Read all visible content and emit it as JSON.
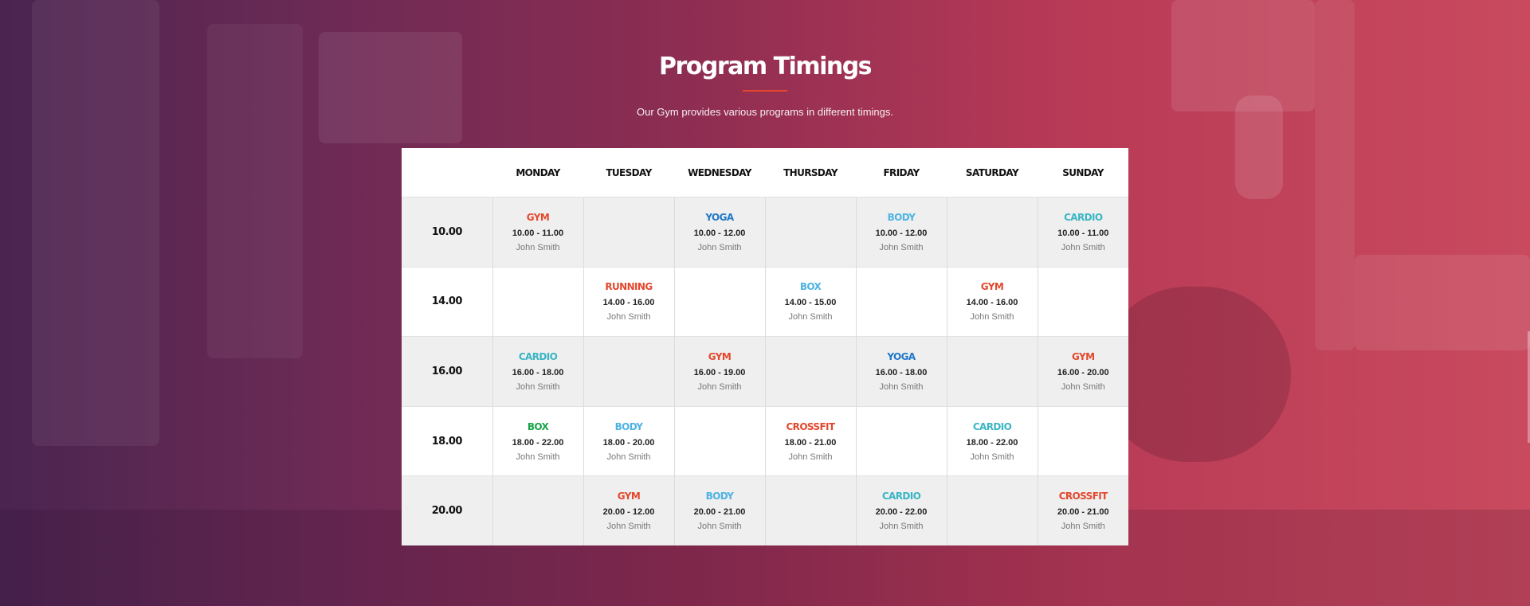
{
  "section": {
    "title": "Program Timings",
    "subtitle": "Our Gym provides various programs in different timings."
  },
  "colors": {
    "accent": "#e3482e",
    "program_red": "#e3482e",
    "program_blue": "#1f79c9",
    "program_lightblue": "#4fb3e2",
    "program_teal": "#3ab5c4",
    "program_green": "#18a34a"
  },
  "days": [
    "MONDAY",
    "TUESDAY",
    "WEDNESDAY",
    "THURSDAY",
    "FRIDAY",
    "SATURDAY",
    "SUNDAY"
  ],
  "rows": [
    {
      "time": "10.00",
      "cells": [
        {
          "program": "GYM",
          "color": "#e3482e",
          "time": "10.00 - 11.00",
          "trainer": "John Smith"
        },
        null,
        {
          "program": "YOGA",
          "color": "#1f79c9",
          "time": "10.00 - 12.00",
          "trainer": "John Smith"
        },
        null,
        {
          "program": "BODY",
          "color": "#4fb3e2",
          "time": "10.00 - 12.00",
          "trainer": "John Smith"
        },
        null,
        {
          "program": "CARDIO",
          "color": "#3ab5c4",
          "time": "10.00 - 11.00",
          "trainer": "John Smith"
        }
      ]
    },
    {
      "time": "14.00",
      "cells": [
        null,
        {
          "program": "RUNNING",
          "color": "#e3482e",
          "time": "14.00 - 16.00",
          "trainer": "John Smith"
        },
        null,
        {
          "program": "BOX",
          "color": "#4fb3e2",
          "time": "14.00 - 15.00",
          "trainer": "John Smith"
        },
        null,
        {
          "program": "GYM",
          "color": "#e3482e",
          "time": "14.00 - 16.00",
          "trainer": "John Smith"
        },
        null
      ]
    },
    {
      "time": "16.00",
      "cells": [
        {
          "program": "CARDIO",
          "color": "#3ab5c4",
          "time": "16.00 - 18.00",
          "trainer": "John Smith"
        },
        null,
        {
          "program": "GYM",
          "color": "#e3482e",
          "time": "16.00 - 19.00",
          "trainer": "John Smith"
        },
        null,
        {
          "program": "YOGA",
          "color": "#1f79c9",
          "time": "16.00 - 18.00",
          "trainer": "John Smith"
        },
        null,
        {
          "program": "GYM",
          "color": "#e3482e",
          "time": "16.00 - 20.00",
          "trainer": "John Smith"
        }
      ]
    },
    {
      "time": "18.00",
      "cells": [
        {
          "program": "BOX",
          "color": "#18a34a",
          "time": "18.00 - 22.00",
          "trainer": "John Smith"
        },
        {
          "program": "BODY",
          "color": "#4fb3e2",
          "time": "18.00 - 20.00",
          "trainer": "John Smith"
        },
        null,
        {
          "program": "CROSSFIT",
          "color": "#e3482e",
          "time": "18.00 - 21.00",
          "trainer": "John Smith"
        },
        null,
        {
          "program": "CARDIO",
          "color": "#3ab5c4",
          "time": "18.00 - 22.00",
          "trainer": "John Smith"
        },
        null
      ]
    },
    {
      "time": "20.00",
      "cells": [
        null,
        {
          "program": "GYM",
          "color": "#e3482e",
          "time": "20.00 - 12.00",
          "trainer": "John Smith"
        },
        {
          "program": "BODY",
          "color": "#4fb3e2",
          "time": "20.00 - 21.00",
          "trainer": "John Smith"
        },
        null,
        {
          "program": "CARDIO",
          "color": "#3ab5c4",
          "time": "20.00 - 22.00",
          "trainer": "John Smith"
        },
        null,
        {
          "program": "CROSSFIT",
          "color": "#e3482e",
          "time": "20.00 - 21.00",
          "trainer": "John Smith"
        }
      ]
    }
  ]
}
